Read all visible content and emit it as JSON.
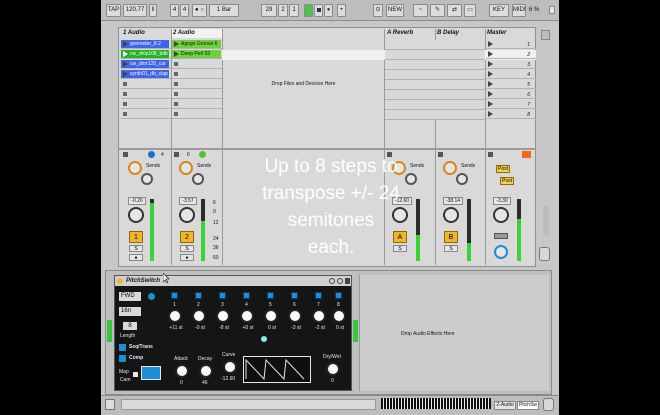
{
  "toolbar": {
    "tap": "TAP",
    "tempo": "120.77",
    "sig_num": "4",
    "sig_den": "4",
    "metro": "● ○",
    "quant": "1 Bar",
    "pos_bar": "29",
    "pos_beat": "2",
    "pos_sixteenth": "1",
    "new": "NEW",
    "key": "KEY",
    "midi": "MIDI",
    "cpu": "6 %"
  },
  "tracks": [
    {
      "name": "1 Audio",
      "clips": [
        "goometer_8.2",
        "cw_dnlp108_bdb",
        "cw_dnrr120_cur",
        "synth01_db_clap"
      ],
      "clip_colors": [
        "#3f63ea",
        "#23b323",
        "#3f63ea",
        "#3f63ea"
      ],
      "volume": "-0.20",
      "activator": "1",
      "color": "#f2b429"
    },
    {
      "name": "2 Audio",
      "clips": [
        "Agogo Groove 6",
        "Deep Perl 03"
      ],
      "clip_colors": [
        "#6ed23c",
        "#6ed23c"
      ],
      "volume": "-3.57",
      "activator": "2",
      "color": "#f2b429"
    }
  ],
  "returns": [
    {
      "name": "A Reverb",
      "volume": "-12.60",
      "activator": "A"
    },
    {
      "name": "B Delay",
      "volume": "-38.14",
      "activator": "B"
    }
  ],
  "master": {
    "name": "Master",
    "scenes": [
      "1",
      "2",
      "3",
      "4",
      "5",
      "6",
      "7",
      "8"
    ],
    "volume": "-3.30"
  },
  "drop_files": "Drop Files and Devices Here",
  "drop_effects": "Drop Audio Effects Here",
  "sends_label": "Sends",
  "scale": [
    "6",
    "0",
    "12",
    "24",
    "36",
    "60"
  ],
  "overlay": [
    "Up to 8 steps  to",
    "transpose +/- 24",
    "semitones",
    "each."
  ],
  "post_label": "Post",
  "device": {
    "title": "PitchSwitch",
    "direction": "FWD",
    "rate": "16n",
    "length_value": "8",
    "length_label": "Length",
    "seq_trans": "Seq/Trans",
    "comp": "Comp",
    "map": "Map",
    "cam": "Cam",
    "steps": [
      "1",
      "2",
      "3",
      "4",
      "5",
      "6",
      "7",
      "8"
    ],
    "step_values": [
      "+11 st",
      "-0 st",
      "-8 st",
      "+0 st",
      "0 st",
      "-3 st",
      "-2 st",
      "0 st"
    ],
    "attack_label": "Attack",
    "attack": "0",
    "decay_label": "Decay",
    "decay": "46",
    "curve_label": "Curve",
    "curve": "-12.60",
    "drywet_label": "Dry/Wet",
    "drywet": "0"
  },
  "status": {
    "track": "2-Audio",
    "device": "PitchSw"
  }
}
